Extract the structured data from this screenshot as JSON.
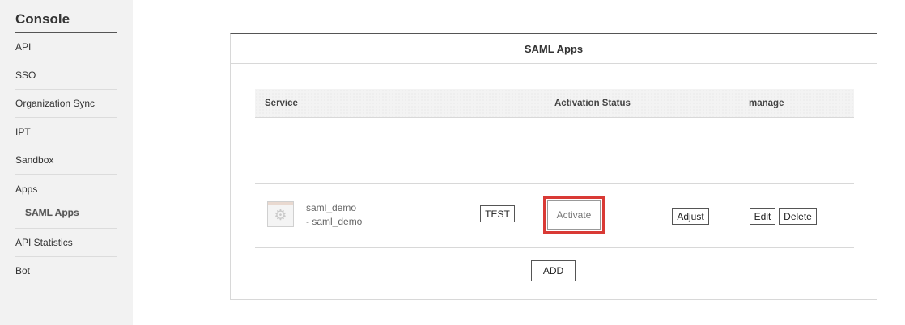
{
  "sidebar": {
    "title": "Console",
    "items": [
      {
        "label": "API"
      },
      {
        "label": "SSO"
      },
      {
        "label": "Organization Sync"
      },
      {
        "label": "IPT"
      },
      {
        "label": "Sandbox"
      },
      {
        "label": "Apps",
        "sub": "SAML Apps"
      },
      {
        "label": "API Statistics"
      },
      {
        "label": "Bot"
      }
    ]
  },
  "panel": {
    "title": "SAML Apps",
    "columns": {
      "service": "Service",
      "activation_status": "Activation Status",
      "manage": "manage"
    },
    "rows": [
      {
        "icon": "gear-icon",
        "name": "saml_demo",
        "subname": "- saml_demo",
        "test_label": "TEST",
        "activate_label": "Activate",
        "adjust_label": "Adjust",
        "edit_label": "Edit",
        "delete_label": "Delete"
      }
    ],
    "add_label": "ADD"
  },
  "colors": {
    "highlight": "#d93a35",
    "sidebar_bg": "#f2f2f2"
  }
}
